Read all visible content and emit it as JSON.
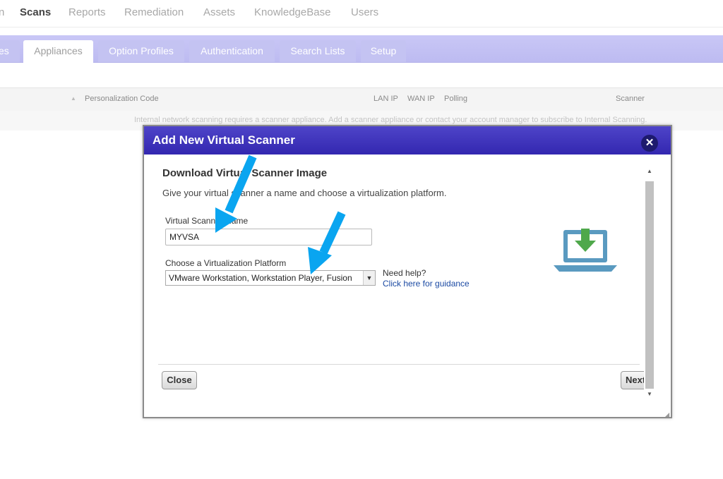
{
  "topnav": {
    "items": [
      "n",
      "Scans",
      "Reports",
      "Remediation",
      "Assets",
      "KnowledgeBase",
      "Users"
    ],
    "active": "Scans"
  },
  "tabs": [
    "es",
    "Appliances",
    "Option Profiles",
    "Authentication",
    "Search Lists",
    "Setup"
  ],
  "active_tab": "Appliances",
  "table": {
    "headers": [
      "Personalization Code",
      "LAN IP",
      "WAN IP",
      "Polling",
      "Scanner"
    ],
    "empty_message": "Internal network scanning requires a scanner appliance. Add a scanner appliance or contact your account manager to subscribe to Internal Scanning."
  },
  "dialog": {
    "title": "Add New Virtual Scanner",
    "heading": "Download Virtual Scanner Image",
    "subtext": "Give your virtual scanner a name and choose a virtualization platform.",
    "name_label": "Virtual Scanner Name",
    "name_value": "MYVSA",
    "platform_label": "Choose a Virtualization Platform",
    "platform_value": "VMware Workstation, Workstation Player, Fusion",
    "help_question": "Need help?",
    "help_link": "Click here for guidance",
    "close_button": "Close",
    "next_button": "Next"
  },
  "icons": {
    "dialog_close": "close-icon",
    "illustration": "laptop-download-icon",
    "annotation": "blue-arrow-icon"
  },
  "colors": {
    "titlebar": "#3b2fb8",
    "tabbar": "#c5c3f3",
    "annotation_arrow": "#0aa5f0",
    "laptop": "#5a9ac0",
    "download_arrow": "#4fa84b"
  }
}
